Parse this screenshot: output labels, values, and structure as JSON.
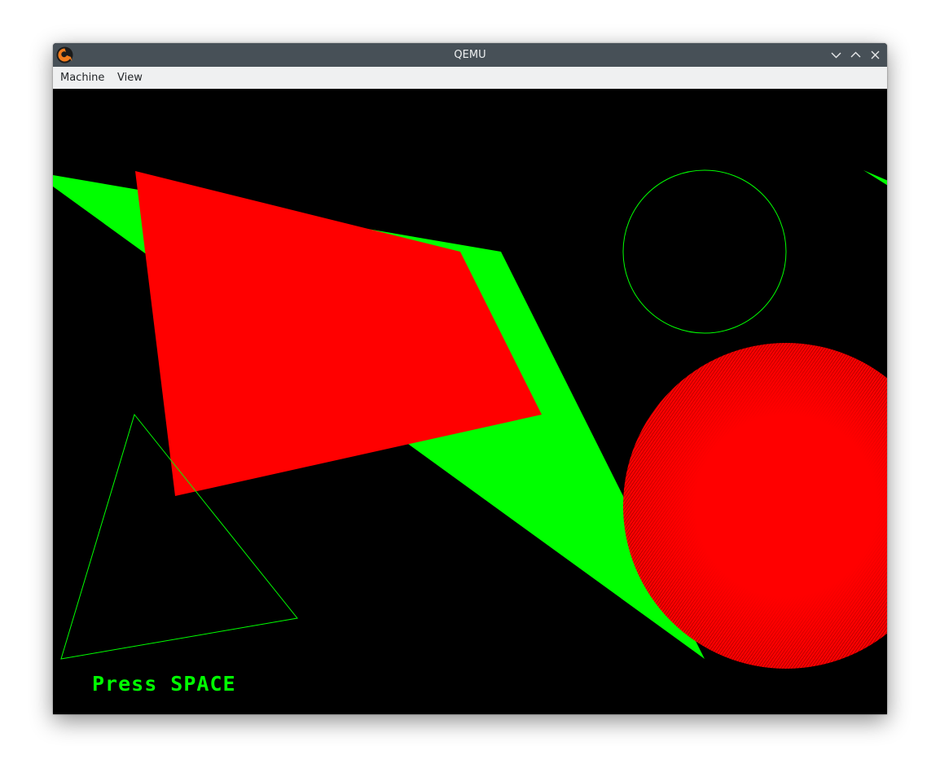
{
  "window": {
    "title": "QEMU",
    "icon": "qemu-logo-icon",
    "controls": [
      "minimize-icon",
      "maximize-icon",
      "close-icon"
    ]
  },
  "menu": {
    "items": [
      {
        "label": "Machine"
      },
      {
        "label": "View"
      }
    ]
  },
  "screen": {
    "prompt": "Press SPACE",
    "colors": {
      "background": "#000000",
      "green": "#00ff00",
      "red": "#ff0000"
    }
  }
}
